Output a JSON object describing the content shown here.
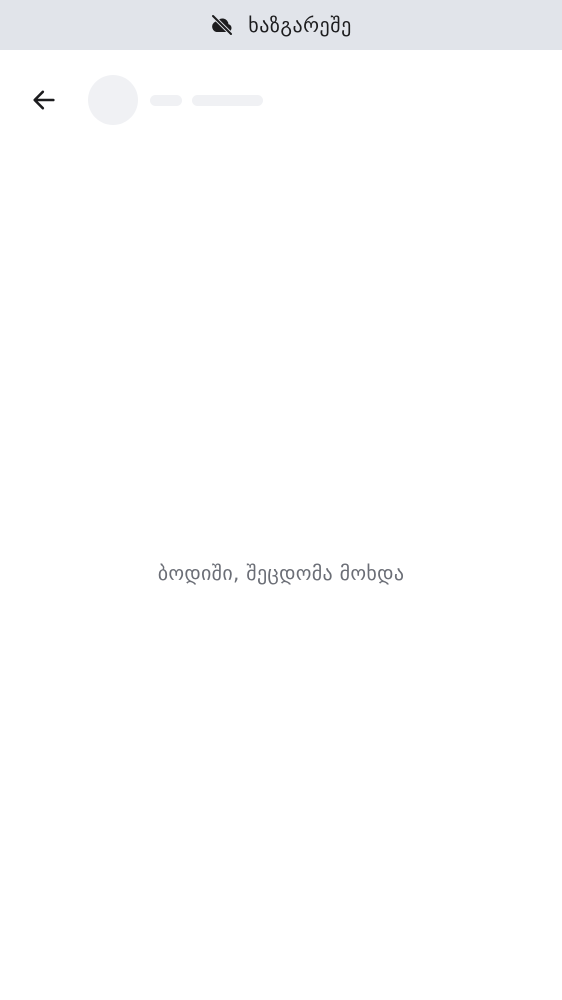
{
  "banner": {
    "icon": "cloud-off-icon",
    "text": "ხაზგარეშე"
  },
  "header": {
    "back_icon": "arrow-left-icon"
  },
  "main": {
    "error_message": "ბოდიში, შეცდომა მოხდა"
  },
  "colors": {
    "banner_bg": "#e1e4ea",
    "skeleton": "#f0f1f4",
    "error_text": "#6b6e76"
  }
}
